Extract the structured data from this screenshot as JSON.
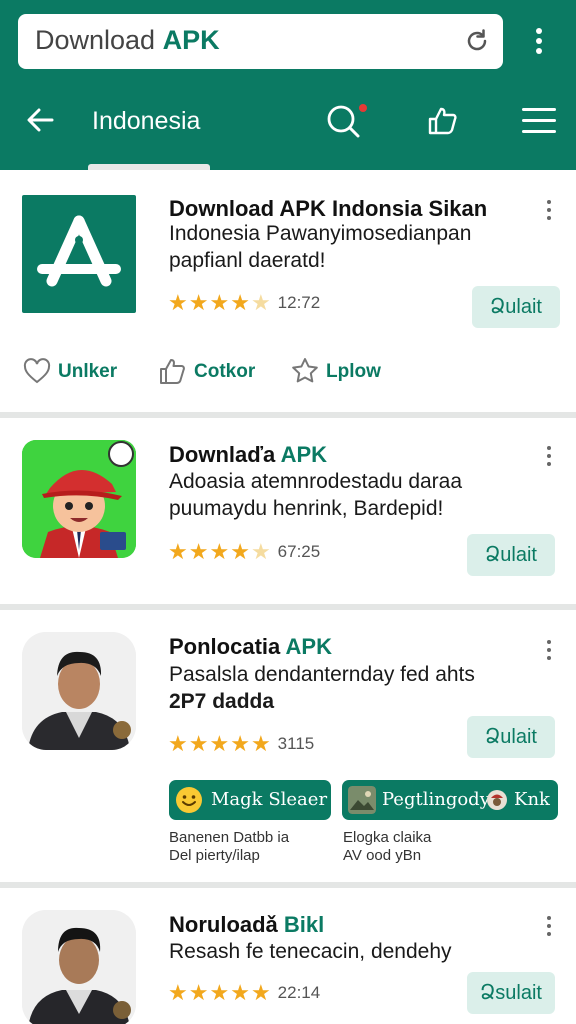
{
  "browser": {
    "address_prefix": "Download ",
    "address_accent": "APK"
  },
  "nav": {
    "title": "Indonesia"
  },
  "apps": [
    {
      "title": "Download APK Indonsia Sikan",
      "description": "Indonesia Pawanyimosedianpan papfianl daeratd!",
      "rating": 4,
      "rating_text": "12:72",
      "button": "Ձulait"
    },
    {
      "title": "Downlaďa ",
      "title_accent": "APK",
      "description": "Adoasia atemnrodestadu daraa puumaydu henrink, Bardepid!",
      "rating": 4,
      "rating_text": "67:25",
      "button": "Ձulait"
    },
    {
      "title": "Ponlocatia ",
      "title_accent": "APK",
      "description": "Pasalsla dendanternday fed ahts",
      "description_bold": "2P7 dadda",
      "rating": 5,
      "rating_text": "3115",
      "button": "Ձulait"
    },
    {
      "title": "Noruloadǎ ",
      "title_accent": "Bikl",
      "description": "Resash fe tenecacin, dendehy",
      "rating": 5,
      "rating_text": "22:14",
      "button": "Ձsulait"
    }
  ],
  "actions": [
    {
      "label": "Unlker",
      "icon": "heart-icon"
    },
    {
      "label": "Cotkor",
      "icon": "thumbs-up-icon"
    },
    {
      "label": "Lplow",
      "icon": "star-icon"
    }
  ],
  "chips": [
    {
      "label": "Magk Sleaer",
      "icon": "smiley-icon",
      "sub1": "Banenen Datbb ia",
      "sub2": "Del pierty/ilap"
    },
    {
      "label": "Pegtlingody",
      "trailing": "Knk",
      "icon": "image-icon",
      "sub1": "Elogka claika",
      "sub2": "AV ooԁ yBn"
    }
  ],
  "colors": {
    "brand": "#0b7a63",
    "star": "#f2a81d",
    "button_bg": "#dbefea"
  }
}
